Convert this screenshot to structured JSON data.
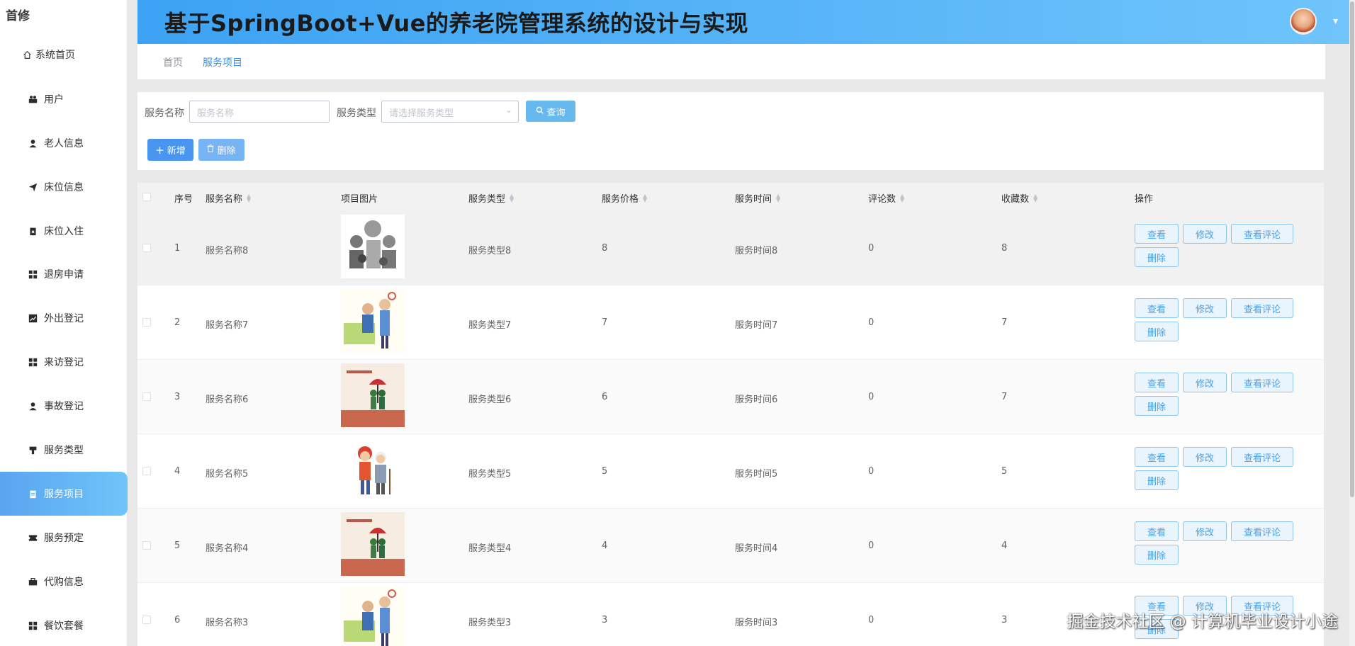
{
  "sidebar": {
    "logo": "首修",
    "items": [
      {
        "label": "系统首页",
        "icon": "home-icon"
      },
      {
        "label": "用户",
        "icon": "user-group-icon"
      },
      {
        "label": "老人信息",
        "icon": "person-icon"
      },
      {
        "label": "床位信息",
        "icon": "send-icon"
      },
      {
        "label": "床位入住",
        "icon": "clipboard-x-icon"
      },
      {
        "label": "退房申请",
        "icon": "grid-icon"
      },
      {
        "label": "外出登记",
        "icon": "chart-icon"
      },
      {
        "label": "来访登记",
        "icon": "grid-icon"
      },
      {
        "label": "事故登记",
        "icon": "person-icon"
      },
      {
        "label": "服务类型",
        "icon": "hammer-icon"
      },
      {
        "label": "服务项目",
        "icon": "clipboard-icon",
        "active": true
      },
      {
        "label": "服务预定",
        "icon": "ticket-icon"
      },
      {
        "label": "代购信息",
        "icon": "briefcase-icon"
      },
      {
        "label": "餐饮套餐",
        "icon": "grid-icon"
      }
    ]
  },
  "header": {
    "title": "基于SpringBoot+Vue的养老院管理系统的设计与实现"
  },
  "breadcrumb": {
    "home": "首页",
    "current": "服务项目"
  },
  "search": {
    "name_label": "服务名称",
    "name_placeholder": "服务名称",
    "type_label": "服务类型",
    "type_placeholder": "请选择服务类型",
    "query_label": "查询",
    "add_label": "新增",
    "delete_label": "删除"
  },
  "table": {
    "headers": {
      "index": "序号",
      "name": "服务名称",
      "image": "项目图片",
      "type": "服务类型",
      "price": "服务价格",
      "time": "服务时间",
      "comments": "评论数",
      "favorites": "收藏数",
      "actions": "操作"
    },
    "actions": {
      "view": "查看",
      "edit": "修改",
      "view_comments": "查看评论",
      "delete": "删除"
    },
    "rows": [
      {
        "index": "1",
        "name": "服务名称8",
        "type": "服务类型8",
        "price": "8",
        "time": "服务时间8",
        "comments": "0",
        "favorites": "8"
      },
      {
        "index": "2",
        "name": "服务名称7",
        "type": "服务类型7",
        "price": "7",
        "time": "服务时间7",
        "comments": "0",
        "favorites": "7"
      },
      {
        "index": "3",
        "name": "服务名称6",
        "type": "服务类型6",
        "price": "6",
        "time": "服务时间6",
        "comments": "0",
        "favorites": "7"
      },
      {
        "index": "4",
        "name": "服务名称5",
        "type": "服务类型5",
        "price": "5",
        "time": "服务时间5",
        "comments": "0",
        "favorites": "5"
      },
      {
        "index": "5",
        "name": "服务名称4",
        "type": "服务类型4",
        "price": "4",
        "time": "服务时间4",
        "comments": "0",
        "favorites": "4"
      },
      {
        "index": "6",
        "name": "服务名称3",
        "type": "服务类型3",
        "price": "3",
        "time": "服务时间3",
        "comments": "0",
        "favorites": "3"
      }
    ]
  },
  "watermark": "掘金技术社区 @ 计算机毕业设计小途",
  "colors": {
    "header_gradient_start": "#3ca2f3",
    "header_gradient_end": "#6fc4fb",
    "active_menu": "#5aa4f0",
    "op_button_border": "#8cc5ee"
  }
}
